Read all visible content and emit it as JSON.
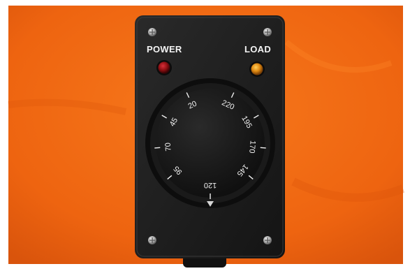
{
  "panel": {
    "power_label": "POWER",
    "load_label": "LOAD"
  },
  "dial": {
    "ticks": [
      "20",
      "45",
      "70",
      "95",
      "120",
      "145",
      "170",
      "195",
      "220"
    ]
  },
  "colors": {
    "background": "#f26a12",
    "housing": "#1b1b1b",
    "knob": "#141414",
    "dial_text": "#f2f2f2",
    "power_led": "#8e0f12",
    "load_led": "#e08a12"
  }
}
